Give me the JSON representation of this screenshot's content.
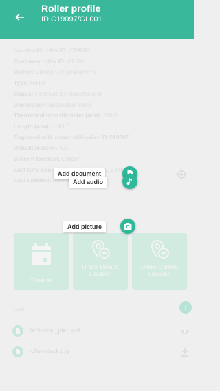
{
  "header": {
    "title": "Roller profile",
    "subtitle": "ID C19097/GL001",
    "back_icon": "arrow-left-icon",
    "color": "#3ab89c"
  },
  "details": [
    {
      "label": "countroll® roller ID:",
      "value": "C19097"
    },
    {
      "label": "Customer roller ID:",
      "value": "GL001"
    },
    {
      "label": "Owner:",
      "value": "Globex Corporation Pro"
    },
    {
      "label": "Type:",
      "value": "Roller"
    },
    {
      "label": "Status:",
      "value": "Received by manufacturer"
    },
    {
      "label": "Description:",
      "value": "applicateur roller"
    },
    {
      "label": "Theoretical core diameter (mm):",
      "value": "220.0"
    },
    {
      "label": "Length (mm):",
      "value": "1581.0"
    },
    {
      "label": "Engraved with countroll® roller ID",
      "value": "C19097"
    },
    {
      "label": "Default location:",
      "value": "CC"
    },
    {
      "label": "Current location:",
      "value": "Dorpen"
    },
    {
      "label": "Last GPS coordinates:",
      "value": "51.0281755, 3.6055"
    },
    {
      "label": "Last updated:",
      "value": "23/06/2021 11:42"
    }
  ],
  "fab_menu": [
    {
      "label": "Add document",
      "icon": "document-add-icon"
    },
    {
      "label": "Add audio",
      "icon": "music-note-icon"
    },
    {
      "label": "Add picture",
      "icon": "camera-icon"
    }
  ],
  "tiles": [
    {
      "label": "Timeline",
      "icon": "calendar-icon"
    },
    {
      "label": "Unlink Default Location",
      "icon": "location-remove-icon"
    },
    {
      "label": "Unlink Current Location",
      "icon": "location-remove-icon"
    }
  ],
  "folder": {
    "name": "root",
    "add_icon": "plus-icon"
  },
  "files": [
    {
      "name": "Technical_plan.pdf",
      "action_icon": "eye-icon"
    },
    {
      "name": "roller-black.jpg",
      "action_icon": "download-icon"
    }
  ],
  "colors": {
    "accent": "#3ab89c",
    "tile": "#b3ecd4",
    "fab": "#2fb89a"
  }
}
